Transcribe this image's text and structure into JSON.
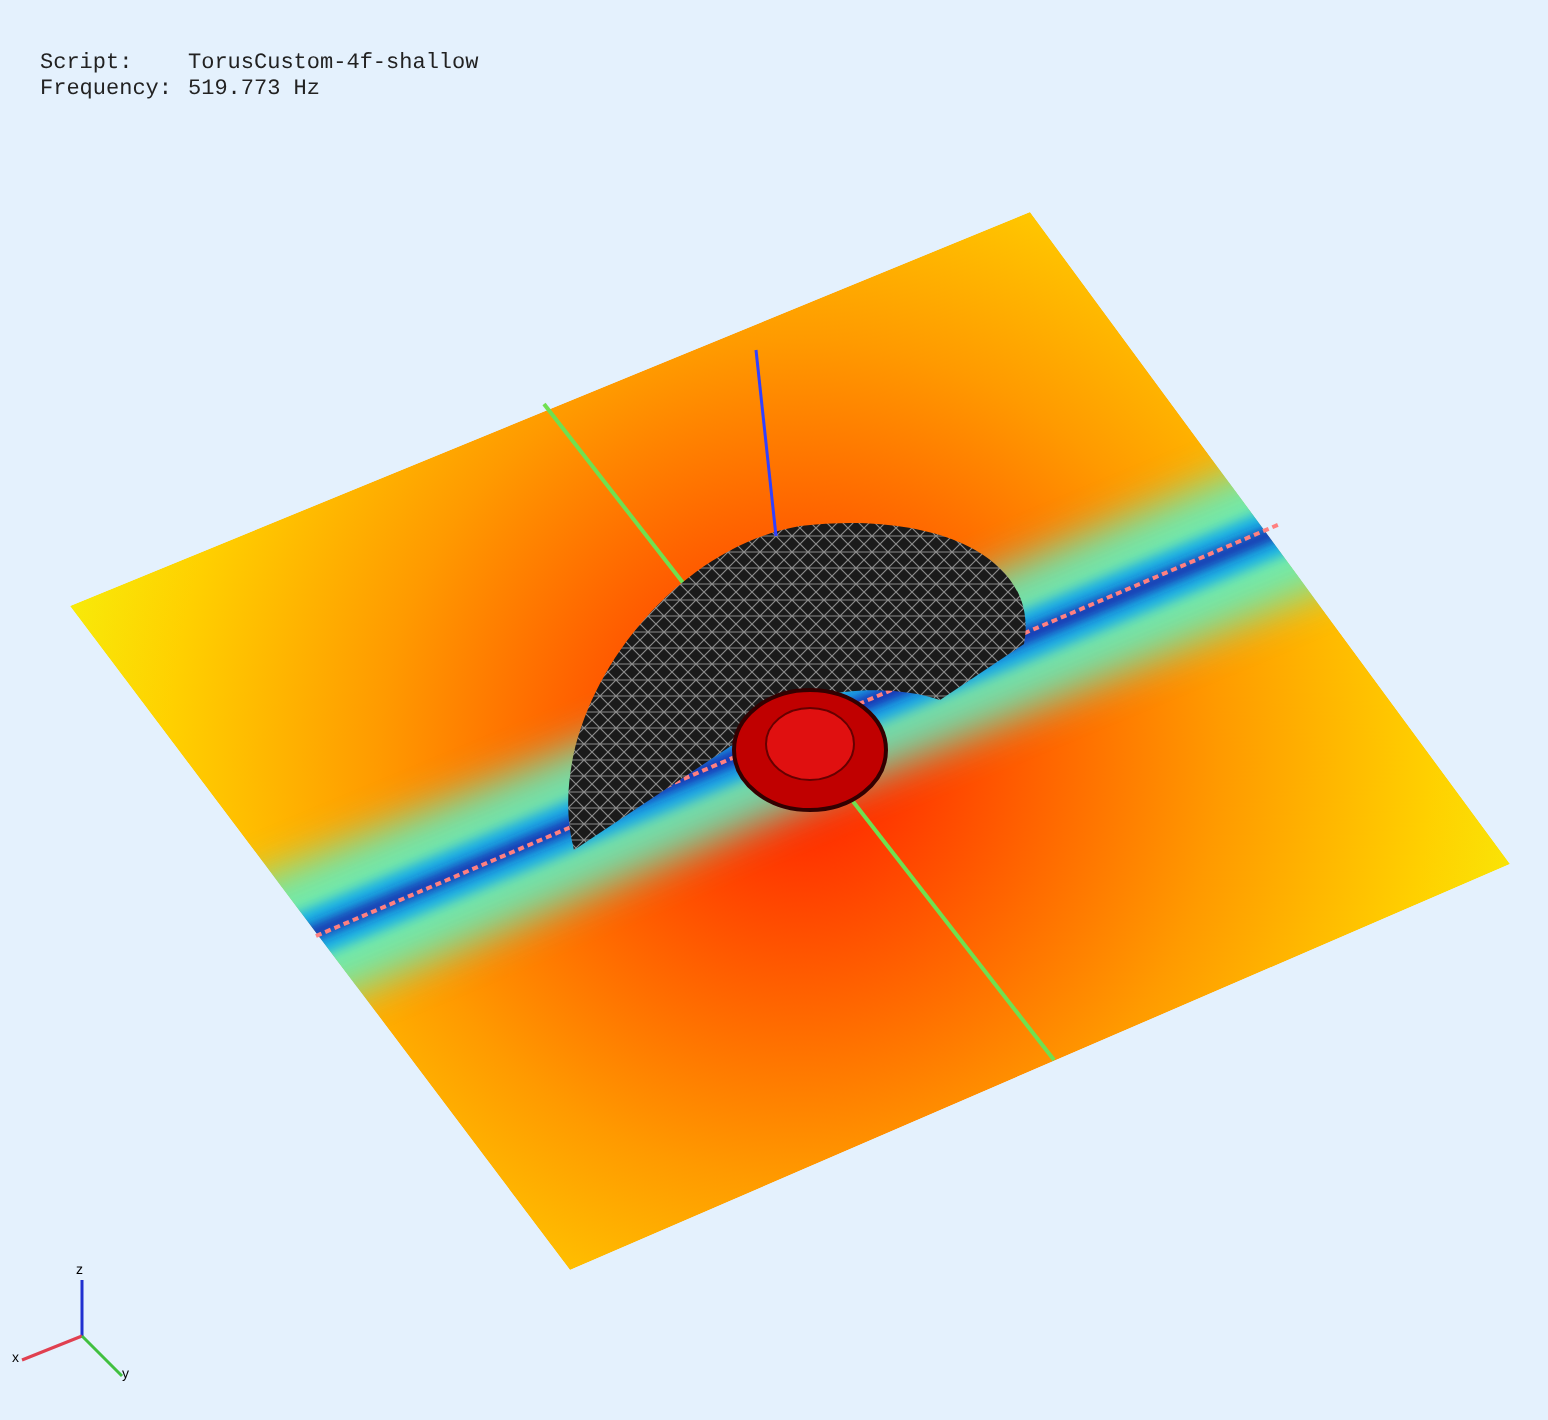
{
  "info": [
    {
      "label": "Script:",
      "value": "TorusCustom-4f-shallow"
    },
    {
      "label": "Frequency:",
      "value": "519.773 Hz"
    }
  ],
  "triad": {
    "labels": [
      "z",
      "x",
      "y"
    ]
  }
}
